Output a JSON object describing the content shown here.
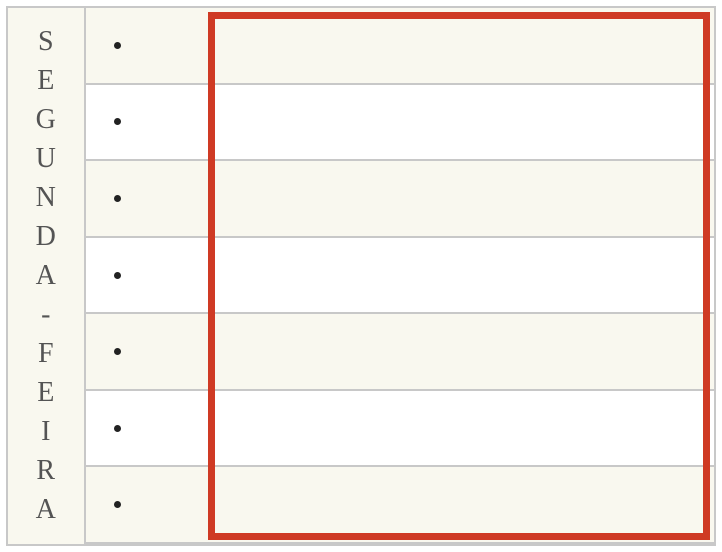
{
  "day_label": "SEGUNDA-FEIRA",
  "rows": [
    {
      "text": ""
    },
    {
      "text": ""
    },
    {
      "text": ""
    },
    {
      "text": ""
    },
    {
      "text": ""
    },
    {
      "text": ""
    },
    {
      "text": ""
    }
  ],
  "highlight_color": "#cf3a24"
}
